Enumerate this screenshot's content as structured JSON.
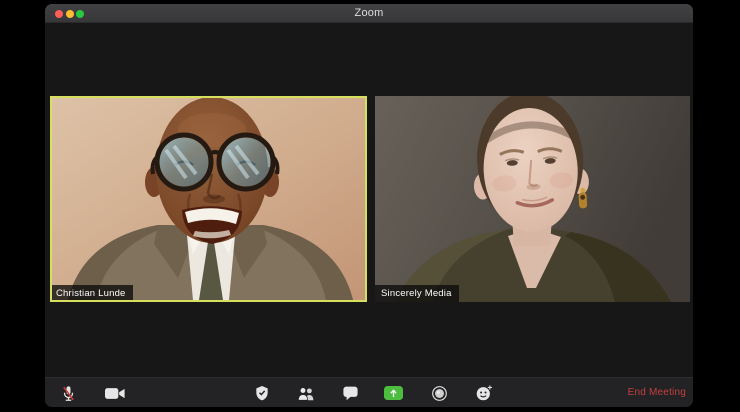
{
  "window": {
    "title": "Zoom",
    "titlebar_bg": "#3a3a3c",
    "content_bg": "#171717",
    "traffic_lights": {
      "close": "#ff5f57",
      "minimize": "#febc2e",
      "fullscreen": "#28c840"
    }
  },
  "tiles": [
    {
      "name": "Christian Lunde",
      "active_speaker": true,
      "border_color": "#d6e05e"
    },
    {
      "name": "Sincerely Media",
      "active_speaker": false,
      "border_color": null
    }
  ],
  "toolbar": {
    "bg": "#232325",
    "buttons": [
      {
        "id": "mute",
        "icon": "microphone-muted-icon",
        "state": "muted"
      },
      {
        "id": "video",
        "icon": "video-camera-icon"
      },
      {
        "id": "security",
        "icon": "shield-icon"
      },
      {
        "id": "participants",
        "icon": "participants-icon"
      },
      {
        "id": "chat",
        "icon": "chat-bubble-icon"
      },
      {
        "id": "share-screen",
        "icon": "share-screen-icon",
        "accent": "#4cbd3e"
      },
      {
        "id": "record",
        "icon": "record-icon"
      },
      {
        "id": "reactions",
        "icon": "reactions-icon"
      }
    ],
    "end_meeting_label": "End Meeting",
    "end_meeting_color": "#c2413c"
  }
}
